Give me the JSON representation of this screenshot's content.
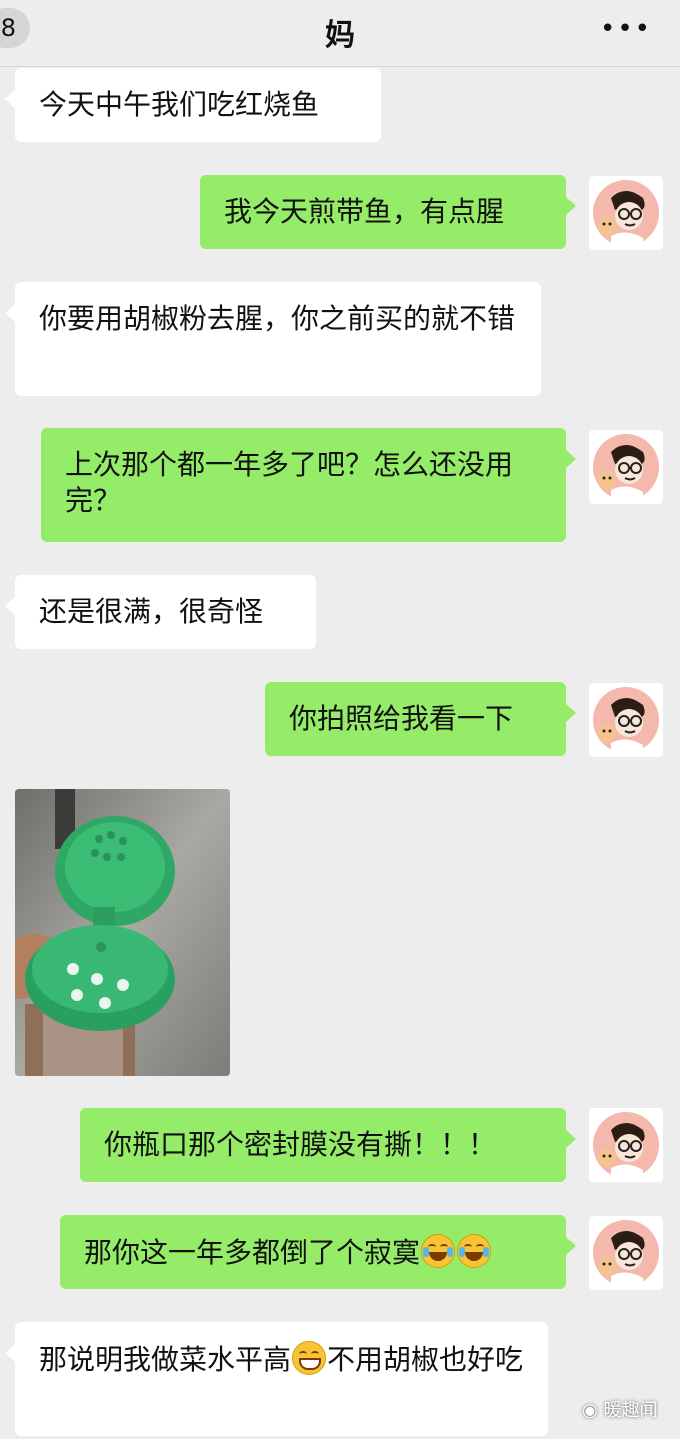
{
  "header": {
    "back_badge": "8",
    "title": "妈",
    "more": "•••"
  },
  "messages": [
    {
      "side": "in",
      "text": "今天中午我们吃红烧鱼"
    },
    {
      "side": "out",
      "text": "我今天煎带鱼，有点腥"
    },
    {
      "side": "in",
      "text": "你要用胡椒粉去腥，你之前买的就不错"
    },
    {
      "side": "out",
      "text": "上次那个都一年多了吧？怎么还没用完？"
    },
    {
      "side": "in",
      "text": "还是很满，很奇怪"
    },
    {
      "side": "out",
      "text": "你拍照给我看一下"
    },
    {
      "side": "in",
      "type": "image",
      "image_description": "green pepper shaker cap"
    },
    {
      "side": "out",
      "text": "你瓶口那个密封膜没有撕！！！"
    },
    {
      "side": "out",
      "text": "那你这一年多都倒了个寂寞",
      "emoji": [
        "crying-laughing",
        "crying-laughing"
      ]
    },
    {
      "side": "in",
      "text_a": "那说明我做菜水平高",
      "emoji": [
        "grinning"
      ],
      "text_b": "不用胡椒也好吃"
    }
  ],
  "watermark": "暖趣闻",
  "colors": {
    "outgoing_bubble": "#95ec69",
    "incoming_bubble": "#ffffff",
    "background": "#ededed"
  }
}
